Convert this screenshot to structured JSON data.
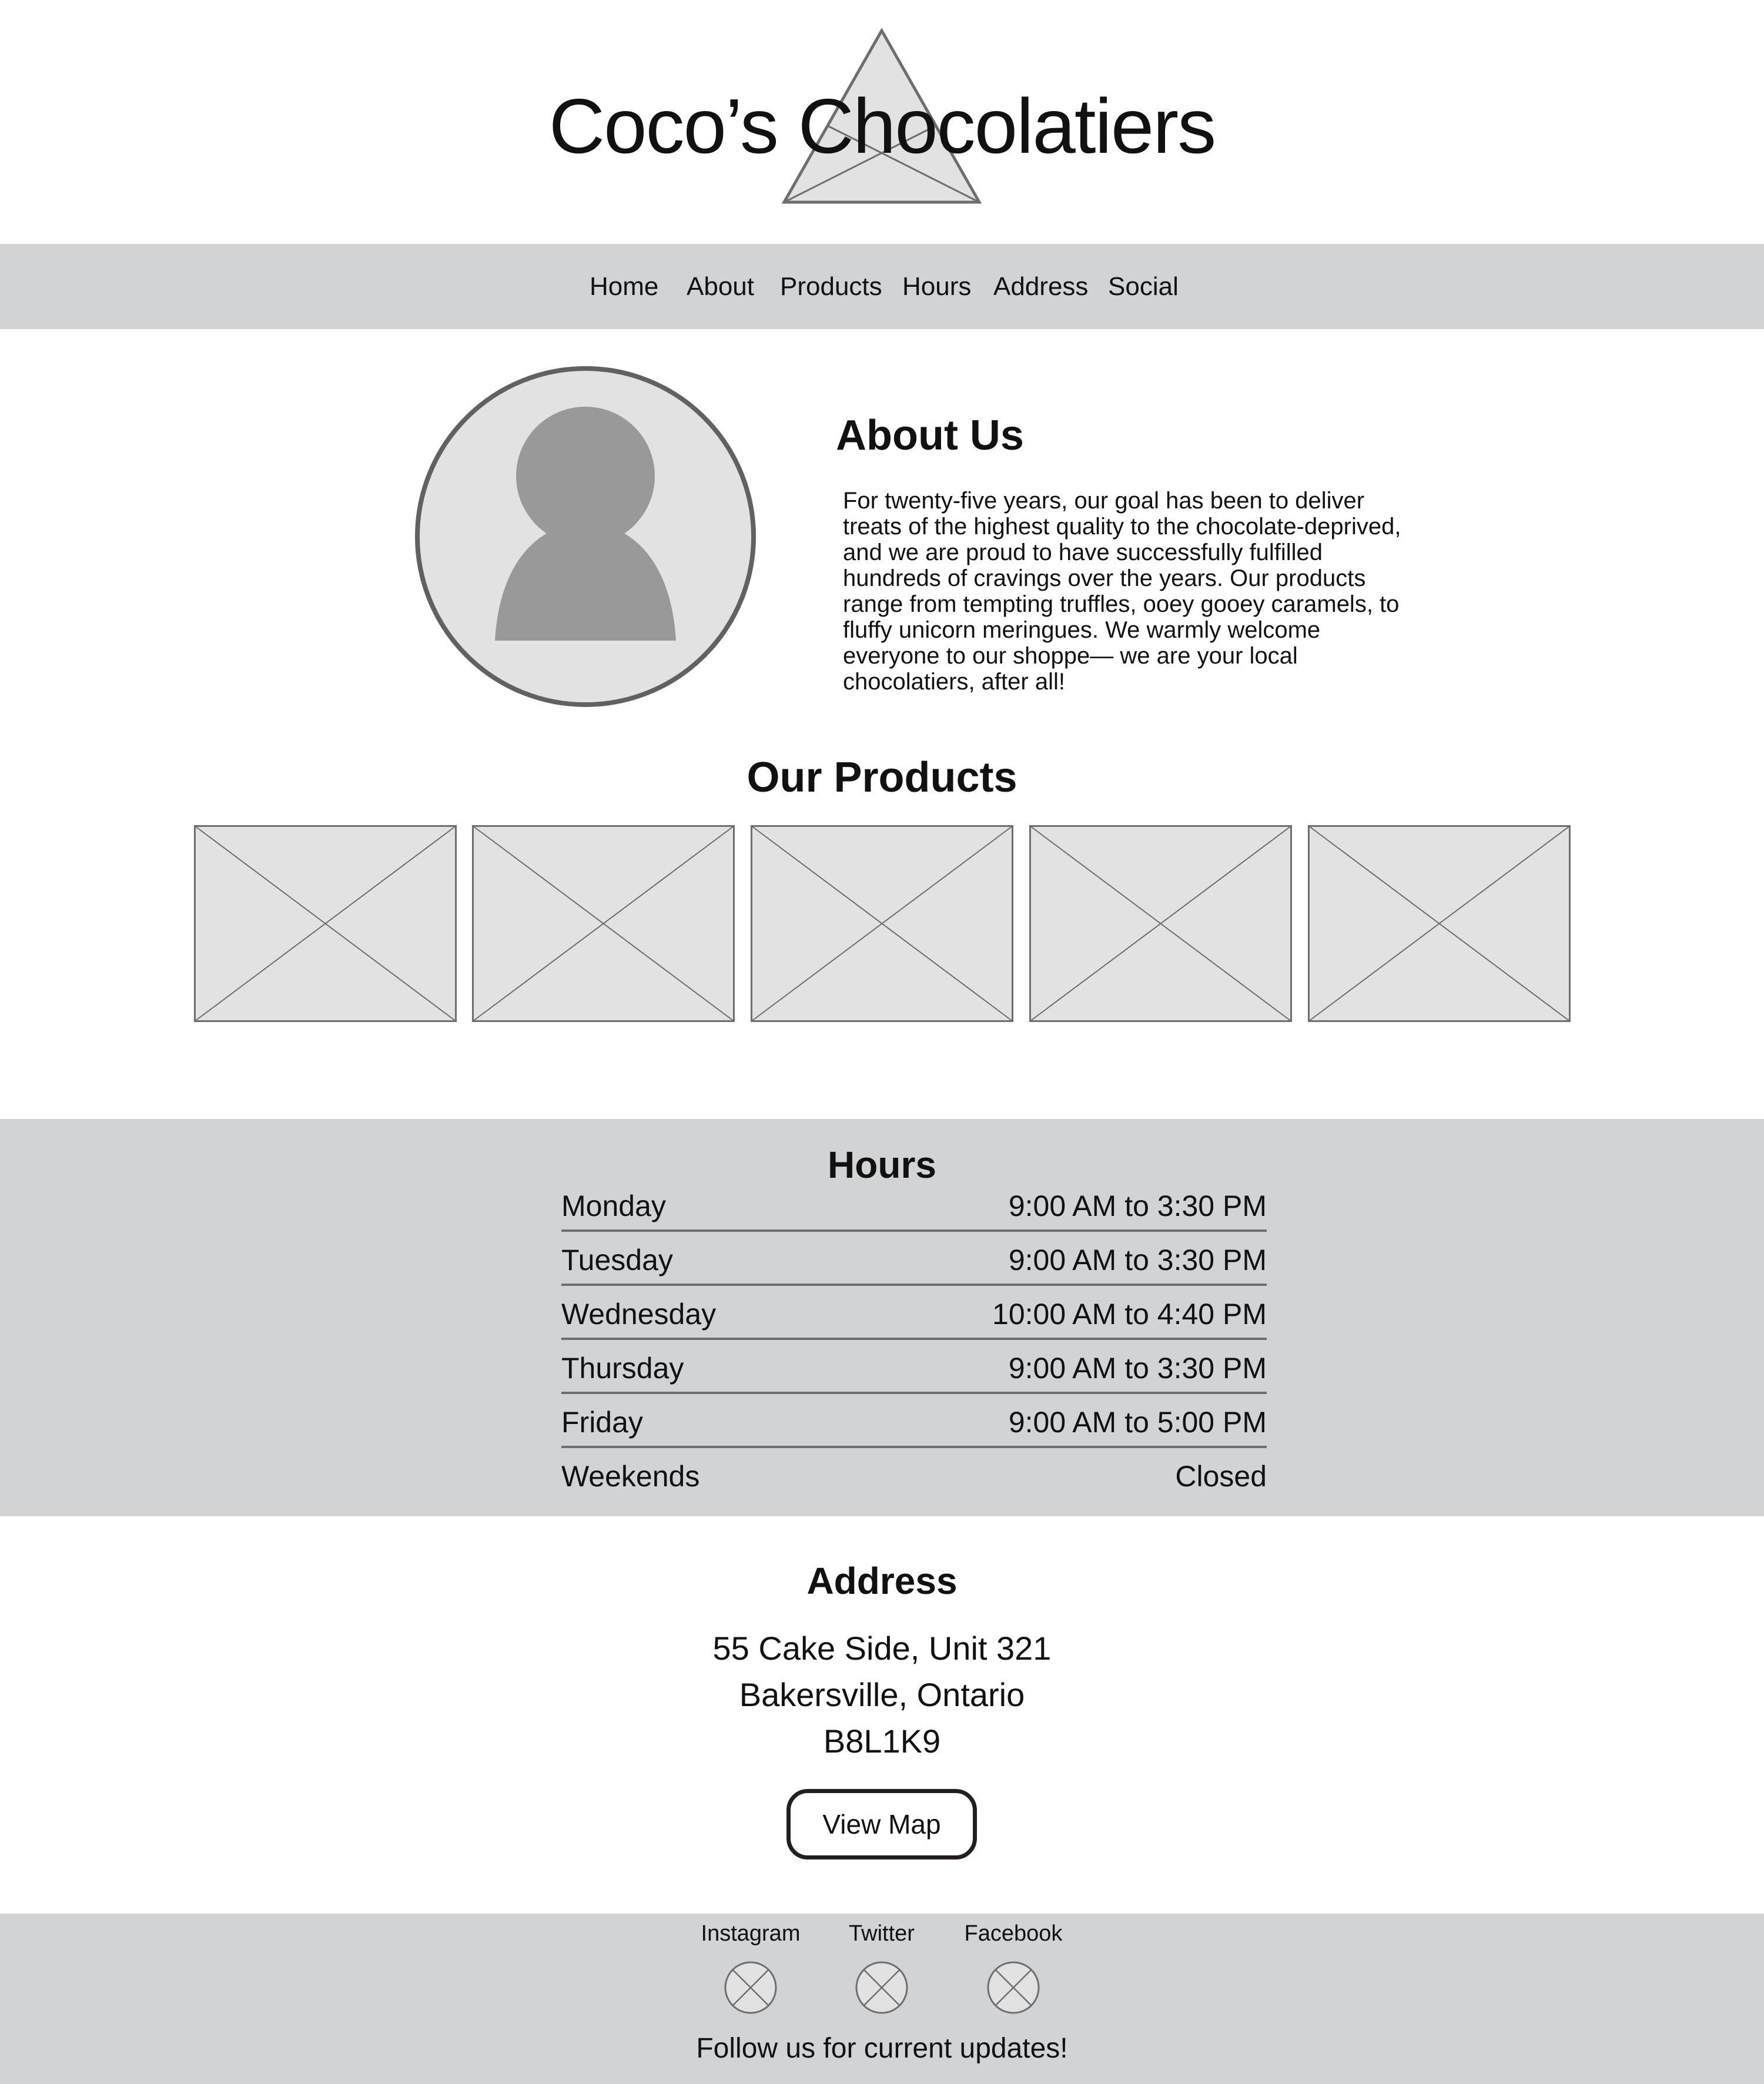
{
  "header": {
    "title": "Coco’s Chocolatiers",
    "logo_icon": "triangle-logo-icon"
  },
  "nav": {
    "items": [
      {
        "label": "Home"
      },
      {
        "label": "About"
      },
      {
        "label": "Products"
      },
      {
        "label": "Hours"
      },
      {
        "label": "Address"
      },
      {
        "label": "Social"
      }
    ]
  },
  "about": {
    "title": "About Us",
    "avatar_icon": "person-avatar-icon",
    "lines": [
      "For twenty-five years, our goal has been to deliver",
      "treats of the highest quality to the chocolate-deprived,",
      "and we are proud to have successfully fulfilled",
      "hundreds of cravings over the years. Our products",
      "range from tempting truffles, ooey gooey caramels, to",
      "fluffy unicorn meringues. We warmly welcome",
      "everyone to our shoppe— we are your local",
      "chocolatiers, after all!"
    ]
  },
  "products": {
    "title": "Our Products",
    "placeholder_icon": "image-placeholder-icon",
    "count": 5
  },
  "hours": {
    "title": "Hours",
    "rows": [
      {
        "day": "Monday",
        "time": "9:00 AM to 3:30 PM"
      },
      {
        "day": "Tuesday",
        "time": "9:00 AM to 3:30 PM"
      },
      {
        "day": "Wednesday",
        "time": "10:00 AM to 4:40 PM"
      },
      {
        "day": "Thursday",
        "time": "9:00 AM to 3:30 PM"
      },
      {
        "day": "Friday",
        "time": "9:00 AM to 5:00 PM"
      },
      {
        "day": "Weekends",
        "time": "Closed"
      }
    ]
  },
  "address": {
    "title": "Address",
    "line1": "55 Cake Side, Unit 321",
    "line2": "Bakersville, Ontario",
    "line3": "B8L1K9",
    "map_button": "View Map"
  },
  "footer": {
    "social": [
      {
        "label": "Instagram",
        "icon": "instagram-placeholder-icon"
      },
      {
        "label": "Twitter",
        "icon": "twitter-placeholder-icon"
      },
      {
        "label": "Facebook",
        "icon": "facebook-placeholder-icon"
      }
    ],
    "follow_text": "Follow us for current updates!"
  },
  "colors": {
    "band_gray": "#d2d3d5",
    "placeholder_fill": "#e2e2e3",
    "placeholder_stroke": "#6d6e71",
    "avatar_figure": "#999999",
    "text": "#111111"
  }
}
